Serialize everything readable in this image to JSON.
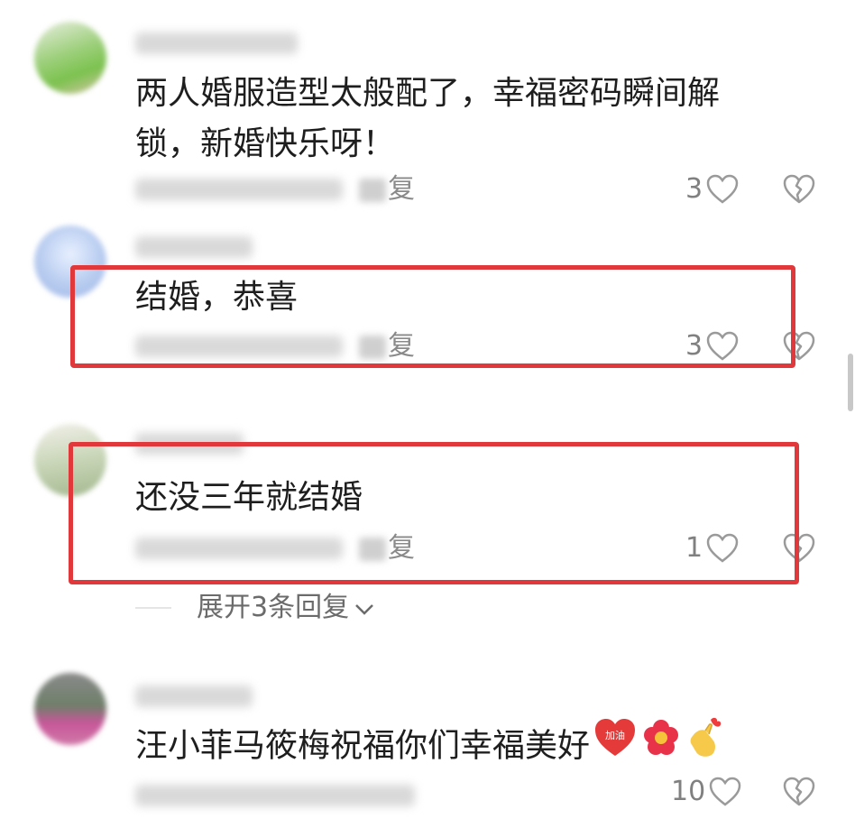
{
  "comments": [
    {
      "content": "两人婚服造型太般配了，幸福密码瞬间解",
      "content_line2": "锁，新婚快乐呀！",
      "reply_label": "复",
      "like_count": "3"
    },
    {
      "content": "结婚，恭喜",
      "reply_label": "复",
      "like_count": "3"
    },
    {
      "content": "还没三年就结婚",
      "reply_label": "复",
      "like_count": "1"
    },
    {
      "content": "汪小菲马筱梅祝福你们幸福美好",
      "emoji_badge_text": "加油",
      "reply_label": "",
      "like_count": "10"
    }
  ],
  "expand_replies": "展开3条回复",
  "colors": {
    "highlight": "#e0383b",
    "text": "#1e1e1e",
    "muted": "#8a8a8a"
  },
  "icons": [
    "heart-outline-icon",
    "broken-heart-icon",
    "chevron-down-icon",
    "heart-jiayou-emoji",
    "flower-emoji",
    "finger-heart-emoji"
  ]
}
